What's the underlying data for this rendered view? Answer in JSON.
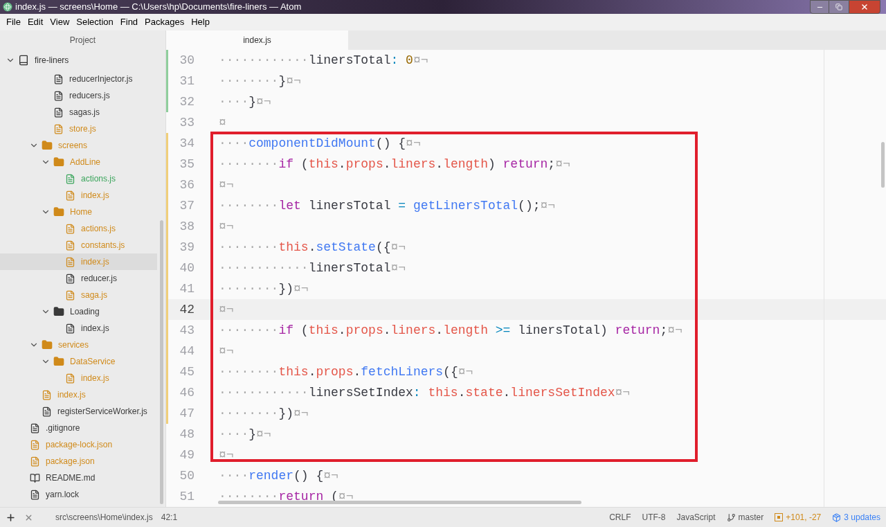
{
  "window": {
    "title": "index.js — screens\\Home — C:\\Users\\hp\\Documents\\fire-liners — Atom"
  },
  "menu": [
    "File",
    "Edit",
    "View",
    "Selection",
    "Find",
    "Packages",
    "Help"
  ],
  "sidebar": {
    "title": "Project",
    "tree": {
      "label": "fire-liners",
      "kind": "repo",
      "expanded": true,
      "children": [
        {
          "kind": "group",
          "children": [
            {
              "kind": "group",
              "children": [
                {
                  "label": "reducerInjector.js",
                  "kind": "file",
                  "color": "#3a3a3a",
                  "selected": false
                },
                {
                  "label": "reducers.js",
                  "kind": "file",
                  "color": "#3a3a3a",
                  "selected": false
                },
                {
                  "label": "sagas.js",
                  "kind": "file",
                  "color": "#3a3a3a",
                  "selected": false
                },
                {
                  "label": "store.js",
                  "kind": "file",
                  "color": "#d08a1a",
                  "selected": false
                }
              ]
            },
            {
              "label": "screens",
              "kind": "folder",
              "color": "#d08a1a",
              "expanded": true,
              "children": [
                {
                  "label": "AddLine",
                  "kind": "folder",
                  "color": "#d08a1a",
                  "expanded": true,
                  "children": [
                    {
                      "label": "actions.js",
                      "kind": "file",
                      "color": "#3ba55c",
                      "selected": false
                    },
                    {
                      "label": "index.js",
                      "kind": "file",
                      "color": "#d08a1a",
                      "selected": false
                    }
                  ]
                },
                {
                  "label": "Home",
                  "kind": "folder",
                  "color": "#d08a1a",
                  "expanded": true,
                  "children": [
                    {
                      "label": "actions.js",
                      "kind": "file",
                      "color": "#d08a1a",
                      "selected": false
                    },
                    {
                      "label": "constants.js",
                      "kind": "file",
                      "color": "#d08a1a",
                      "selected": false
                    },
                    {
                      "label": "index.js",
                      "kind": "file",
                      "color": "#d08a1a",
                      "selected": true
                    },
                    {
                      "label": "reducer.js",
                      "kind": "file",
                      "color": "#3a3a3a",
                      "selected": false
                    },
                    {
                      "label": "saga.js",
                      "kind": "file",
                      "color": "#d08a1a",
                      "selected": false
                    }
                  ]
                },
                {
                  "label": "Loading",
                  "kind": "folder",
                  "color": "#3a3a3a",
                  "expanded": true,
                  "children": [
                    {
                      "label": "index.js",
                      "kind": "file",
                      "color": "#3a3a3a",
                      "selected": false
                    }
                  ]
                }
              ]
            },
            {
              "label": "services",
              "kind": "folder",
              "color": "#d08a1a",
              "expanded": true,
              "children": [
                {
                  "label": "DataService",
                  "kind": "folder",
                  "color": "#d08a1a",
                  "expanded": true,
                  "children": [
                    {
                      "label": "index.js",
                      "kind": "file",
                      "color": "#d08a1a",
                      "selected": false
                    }
                  ]
                }
              ]
            },
            {
              "label": "index.js",
              "kind": "file",
              "color": "#d08a1a",
              "selected": false
            },
            {
              "label": "registerServiceWorker.js",
              "kind": "file",
              "color": "#3a3a3a",
              "selected": false
            }
          ]
        },
        {
          "label": ".gitignore",
          "kind": "file",
          "color": "#3a3a3a",
          "selected": false
        },
        {
          "label": "package-lock.json",
          "kind": "file",
          "color": "#d08a1a",
          "selected": false
        },
        {
          "label": "package.json",
          "kind": "file",
          "color": "#d08a1a",
          "selected": false
        },
        {
          "label": "README.md",
          "kind": "readme",
          "color": "#3a3a3a",
          "selected": false
        },
        {
          "label": "yarn.lock",
          "kind": "file",
          "color": "#3a3a3a",
          "selected": false
        }
      ]
    }
  },
  "tabs": [
    {
      "label": "index.js",
      "selected": true
    }
  ],
  "editor": {
    "lines": [
      {
        "number": "30",
        "added": true,
        "modified": false,
        "current": false,
        "tokens": [
          {
            "t": "············",
            "kind": "ws"
          },
          {
            "t": "linersTotal",
            "kind": "plain"
          },
          {
            "t": ": ",
            "kind": "op"
          },
          {
            "t": "0",
            "kind": "num"
          },
          {
            "t": "¤¬",
            "kind": "ws"
          }
        ]
      },
      {
        "number": "31",
        "added": true,
        "modified": false,
        "current": false,
        "tokens": [
          {
            "t": "········",
            "kind": "ws"
          },
          {
            "t": "}",
            "kind": "plain"
          },
          {
            "t": "¤¬",
            "kind": "ws"
          }
        ]
      },
      {
        "number": "32",
        "added": true,
        "modified": false,
        "current": false,
        "tokens": [
          {
            "t": "····",
            "kind": "ws"
          },
          {
            "t": "}",
            "kind": "plain"
          },
          {
            "t": "¤¬",
            "kind": "ws"
          }
        ]
      },
      {
        "number": "33",
        "added": false,
        "modified": false,
        "current": false,
        "tokens": [
          {
            "t": "¤",
            "kind": "ws"
          }
        ]
      },
      {
        "number": "34",
        "added": false,
        "modified": true,
        "current": false,
        "tokens": [
          {
            "t": "····",
            "kind": "ws"
          },
          {
            "t": "componentDidMount",
            "kind": "func"
          },
          {
            "t": "() {",
            "kind": "plain"
          },
          {
            "t": "¤¬",
            "kind": "ws"
          }
        ]
      },
      {
        "number": "35",
        "added": false,
        "modified": true,
        "current": false,
        "tokens": [
          {
            "t": "········",
            "kind": "ws"
          },
          {
            "t": "if",
            "kind": "kw"
          },
          {
            "t": " (",
            "kind": "plain"
          },
          {
            "t": "this",
            "kind": "member"
          },
          {
            "t": ".",
            "kind": "plain"
          },
          {
            "t": "props",
            "kind": "member"
          },
          {
            "t": ".",
            "kind": "plain"
          },
          {
            "t": "liners",
            "kind": "member"
          },
          {
            "t": ".",
            "kind": "plain"
          },
          {
            "t": "length",
            "kind": "member"
          },
          {
            "t": ") ",
            "kind": "plain"
          },
          {
            "t": "return",
            "kind": "kw"
          },
          {
            "t": ";",
            "kind": "plain"
          },
          {
            "t": "¤¬",
            "kind": "ws"
          }
        ]
      },
      {
        "number": "36",
        "added": false,
        "modified": true,
        "current": false,
        "tokens": [
          {
            "t": "¤¬",
            "kind": "ws"
          }
        ]
      },
      {
        "number": "37",
        "added": false,
        "modified": true,
        "current": false,
        "tokens": [
          {
            "t": "········",
            "kind": "ws"
          },
          {
            "t": "let",
            "kind": "kw"
          },
          {
            "t": " linersTotal ",
            "kind": "plain"
          },
          {
            "t": "= ",
            "kind": "op"
          },
          {
            "t": "getLinersTotal",
            "kind": "func"
          },
          {
            "t": "();",
            "kind": "plain"
          },
          {
            "t": "¤¬",
            "kind": "ws"
          }
        ]
      },
      {
        "number": "38",
        "added": false,
        "modified": true,
        "current": false,
        "tokens": [
          {
            "t": "¤¬",
            "kind": "ws"
          }
        ]
      },
      {
        "number": "39",
        "added": false,
        "modified": true,
        "current": false,
        "tokens": [
          {
            "t": "········",
            "kind": "ws"
          },
          {
            "t": "this",
            "kind": "member"
          },
          {
            "t": ".",
            "kind": "plain"
          },
          {
            "t": "setState",
            "kind": "func"
          },
          {
            "t": "({",
            "kind": "plain"
          },
          {
            "t": "¤¬",
            "kind": "ws"
          }
        ]
      },
      {
        "number": "40",
        "added": false,
        "modified": true,
        "current": false,
        "tokens": [
          {
            "t": "············",
            "kind": "ws"
          },
          {
            "t": "linersTotal",
            "kind": "plain"
          },
          {
            "t": "¤¬",
            "kind": "ws"
          }
        ]
      },
      {
        "number": "41",
        "added": false,
        "modified": true,
        "current": false,
        "tokens": [
          {
            "t": "········",
            "kind": "ws"
          },
          {
            "t": "})",
            "kind": "plain"
          },
          {
            "t": "¤¬",
            "kind": "ws"
          }
        ]
      },
      {
        "number": "42",
        "added": false,
        "modified": true,
        "current": true,
        "tokens": [
          {
            "t": "¤¬",
            "kind": "ws"
          }
        ]
      },
      {
        "number": "43",
        "added": false,
        "modified": true,
        "current": false,
        "tokens": [
          {
            "t": "········",
            "kind": "ws"
          },
          {
            "t": "if",
            "kind": "kw"
          },
          {
            "t": " (",
            "kind": "plain"
          },
          {
            "t": "this",
            "kind": "member"
          },
          {
            "t": ".",
            "kind": "plain"
          },
          {
            "t": "props",
            "kind": "member"
          },
          {
            "t": ".",
            "kind": "plain"
          },
          {
            "t": "liners",
            "kind": "member"
          },
          {
            "t": ".",
            "kind": "plain"
          },
          {
            "t": "length ",
            "kind": "member"
          },
          {
            "t": ">=",
            "kind": "op"
          },
          {
            "t": " linersTotal) ",
            "kind": "plain"
          },
          {
            "t": "return",
            "kind": "kw"
          },
          {
            "t": ";",
            "kind": "plain"
          },
          {
            "t": "¤¬",
            "kind": "ws"
          }
        ]
      },
      {
        "number": "44",
        "added": false,
        "modified": true,
        "current": false,
        "tokens": [
          {
            "t": "¤¬",
            "kind": "ws"
          }
        ]
      },
      {
        "number": "45",
        "added": false,
        "modified": true,
        "current": false,
        "tokens": [
          {
            "t": "········",
            "kind": "ws"
          },
          {
            "t": "this",
            "kind": "member"
          },
          {
            "t": ".",
            "kind": "plain"
          },
          {
            "t": "props",
            "kind": "member"
          },
          {
            "t": ".",
            "kind": "plain"
          },
          {
            "t": "fetchLiners",
            "kind": "func"
          },
          {
            "t": "({",
            "kind": "plain"
          },
          {
            "t": "¤¬",
            "kind": "ws"
          }
        ]
      },
      {
        "number": "46",
        "added": false,
        "modified": true,
        "current": false,
        "tokens": [
          {
            "t": "············",
            "kind": "ws"
          },
          {
            "t": "linersSetIndex",
            "kind": "plain"
          },
          {
            "t": ": ",
            "kind": "op"
          },
          {
            "t": "this",
            "kind": "member"
          },
          {
            "t": ".",
            "kind": "plain"
          },
          {
            "t": "state",
            "kind": "member"
          },
          {
            "t": ".",
            "kind": "plain"
          },
          {
            "t": "linersSetIndex",
            "kind": "member"
          },
          {
            "t": "¤¬",
            "kind": "ws"
          }
        ]
      },
      {
        "number": "47",
        "added": false,
        "modified": true,
        "current": false,
        "tokens": [
          {
            "t": "········",
            "kind": "ws"
          },
          {
            "t": "})",
            "kind": "plain"
          },
          {
            "t": "¤¬",
            "kind": "ws"
          }
        ]
      },
      {
        "number": "48",
        "added": false,
        "modified": false,
        "current": false,
        "tokens": [
          {
            "t": "····",
            "kind": "ws"
          },
          {
            "t": "}",
            "kind": "plain"
          },
          {
            "t": "¤¬",
            "kind": "ws"
          }
        ]
      },
      {
        "number": "49",
        "added": false,
        "modified": false,
        "current": false,
        "tokens": [
          {
            "t": "¤¬",
            "kind": "ws"
          }
        ]
      },
      {
        "number": "50",
        "added": false,
        "modified": false,
        "current": false,
        "tokens": [
          {
            "t": "····",
            "kind": "ws"
          },
          {
            "t": "render",
            "kind": "func"
          },
          {
            "t": "() {",
            "kind": "plain"
          },
          {
            "t": "¤¬",
            "kind": "ws"
          }
        ]
      },
      {
        "number": "51",
        "added": false,
        "modified": false,
        "current": false,
        "tokens": [
          {
            "t": "········",
            "kind": "ws"
          },
          {
            "t": "return",
            "kind": "kw"
          },
          {
            "t": " (",
            "kind": "plain"
          },
          {
            "t": "¤¬",
            "kind": "ws"
          }
        ]
      }
    ]
  },
  "status_bar": {
    "path": "src\\screens\\Home\\index.js",
    "cursor": "42:1",
    "line_ending": "CRLF",
    "encoding": "UTF-8",
    "grammar": "JavaScript",
    "branch": "master",
    "diff": "+101, -27",
    "updates": "3 updates"
  }
}
